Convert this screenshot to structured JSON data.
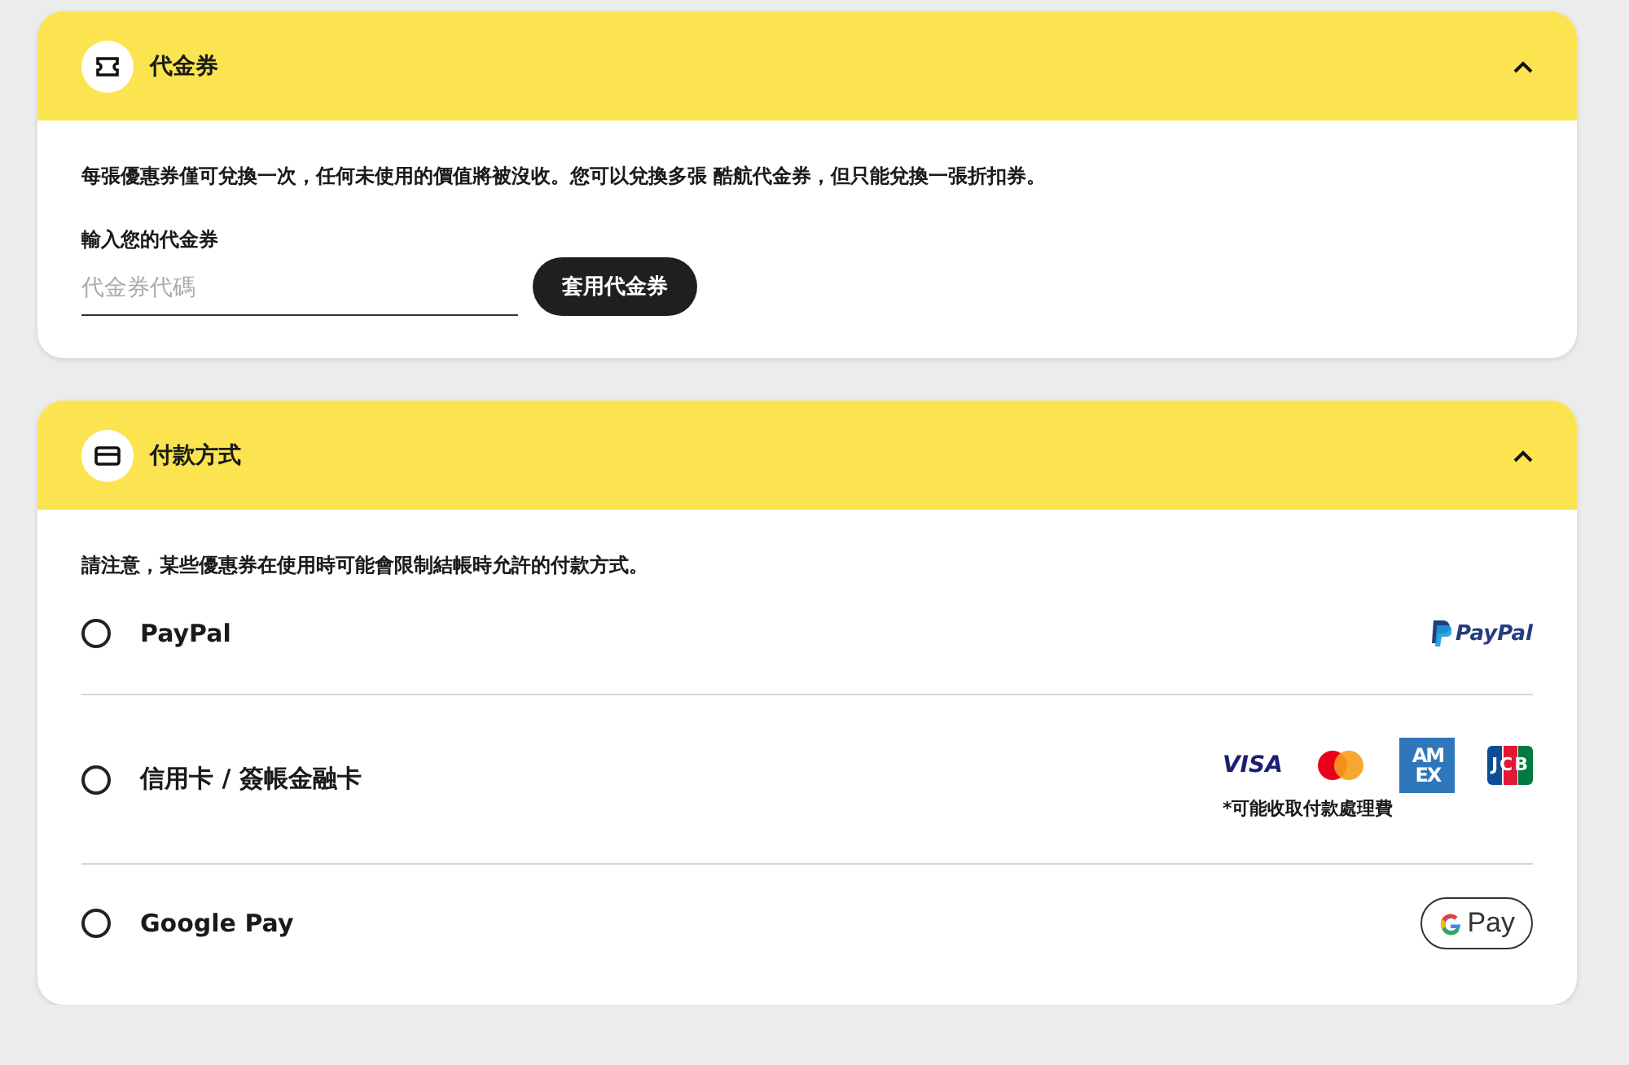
{
  "sections": [
    {
      "kind": "voucher",
      "title": "代金券",
      "expanded": true,
      "note": "每張優惠券僅可兌換一次，任何未使用的價值將被沒收。您可以兌換多張 酷航代金券，但只能兌換一張折扣券。",
      "field_label": "輸入您的代金券",
      "placeholder": "代金券代碼",
      "button": "套用代金券"
    },
    {
      "kind": "payment",
      "title": "付款方式",
      "expanded": true,
      "note": "請注意，某些優惠券在使用時可能會限制結帳時允許的付款方式。",
      "methods": [
        {
          "label": "PayPal",
          "selected": false,
          "logos": [
            {
              "kind": "paypal",
              "text": "PayPal"
            }
          ]
        },
        {
          "label": "信用卡 / 簽帳金融卡",
          "selected": false,
          "logos": [
            {
              "kind": "visa",
              "text": "VISA"
            },
            {
              "kind": "mastercard"
            },
            {
              "kind": "amex",
              "text": "AM EX"
            },
            {
              "kind": "jcb",
              "text": "JCB"
            }
          ],
          "fee_note": "*可能收取付款處理費"
        },
        {
          "label": "Google Pay",
          "selected": false,
          "logos": [
            {
              "kind": "gpay",
              "text": "Pay"
            }
          ]
        }
      ]
    }
  ]
}
